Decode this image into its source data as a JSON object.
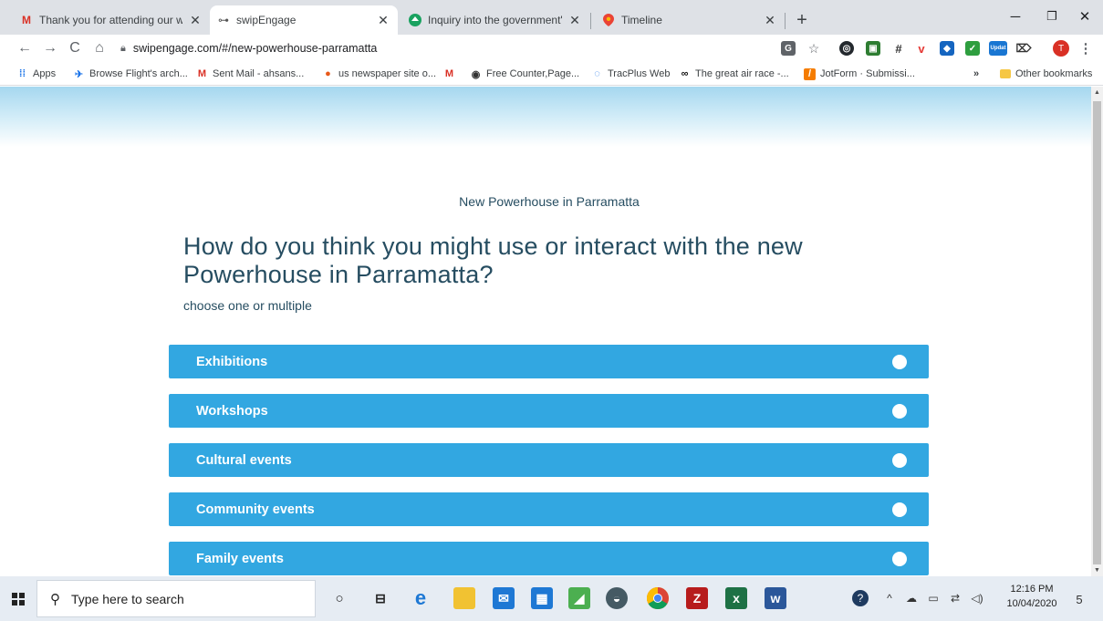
{
  "browser": {
    "tabs": [
      {
        "title": "Thank you for attending our web",
        "icon": "gmail-icon"
      },
      {
        "title": "swipEngage",
        "icon": "swipengage-icon"
      },
      {
        "title": "Inquiry into the government's ma",
        "icon": "upvote-icon"
      },
      {
        "title": "Timeline",
        "icon": "maps-pin-icon"
      }
    ],
    "url": "swipengage.com/#/new-powerhouse-parramatta",
    "bookmarks": [
      {
        "label": "Apps"
      },
      {
        "label": "Browse Flight's arch..."
      },
      {
        "label": "Sent Mail - ahsans..."
      },
      {
        "label": "us newspaper site o..."
      },
      {
        "label": ""
      },
      {
        "label": "Free Counter,Page..."
      },
      {
        "label": "TracPlus Web"
      },
      {
        "label": "The great air race -..."
      },
      {
        "label": "JotForm · Submissi..."
      }
    ],
    "bookmarks_overflow": "»",
    "other_bookmarks": "Other bookmarks",
    "profile_initial": "T",
    "ext_badge": "Updat"
  },
  "page": {
    "survey_label": "New Powerhouse in Parramatta",
    "question": "How do you think you might use or interact with the new Powerhouse in Parramatta?",
    "hint": "choose one or multiple",
    "options": [
      {
        "label": "Exhibitions"
      },
      {
        "label": "Workshops"
      },
      {
        "label": "Cultural events"
      },
      {
        "label": "Community events"
      },
      {
        "label": "Family events"
      }
    ],
    "colors": {
      "option_bg": "#32a7e1",
      "heading": "#264d61"
    }
  },
  "taskbar": {
    "search_placeholder": "Type here to search",
    "time": "12:16 PM",
    "date": "10/04/2020",
    "notification_count": "5"
  }
}
